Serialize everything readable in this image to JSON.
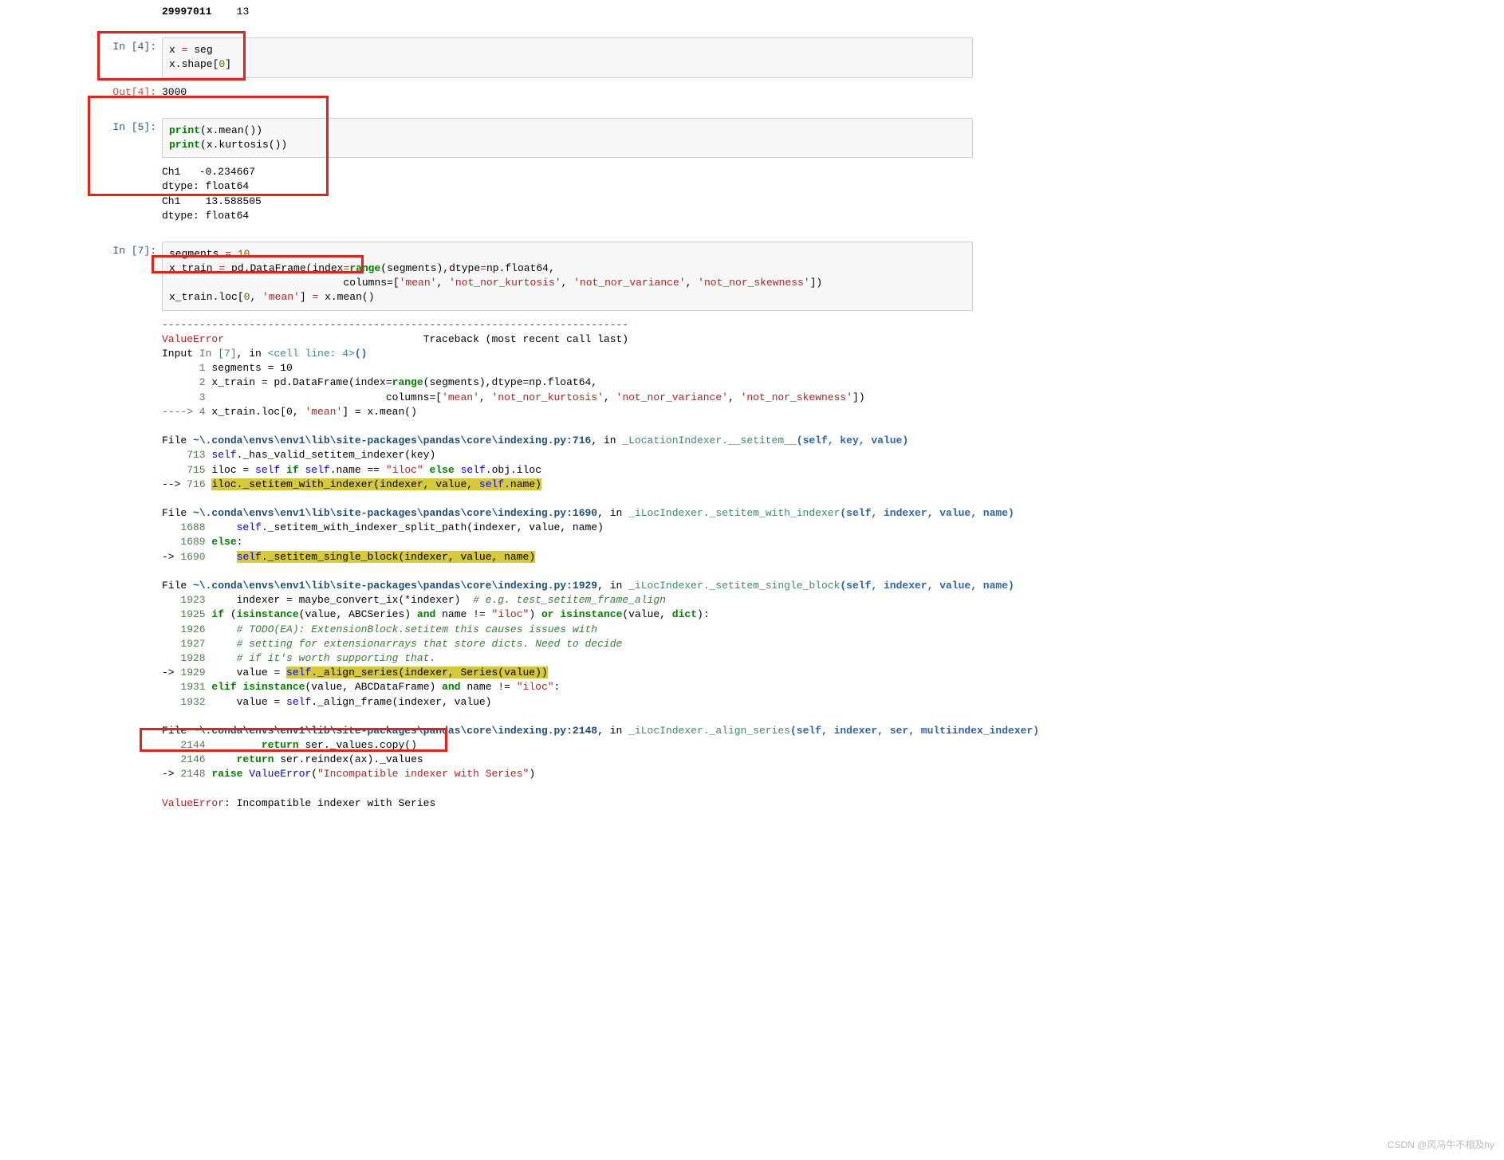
{
  "watermark": "CSDN @风马牛不相及hy",
  "top_out": {
    "a": "29997011",
    "b": "13"
  },
  "cell4": {
    "prompt": "In  [4]:",
    "code_l1a": "x ",
    "op_eq": "=",
    "code_l1b": " seg",
    "code_l2a": "x.shape[",
    "num0": "0",
    "code_l2c": "]"
  },
  "out4": {
    "prompt": "Out[4]:",
    "val": "3000"
  },
  "cell5": {
    "prompt": "In  [5]:",
    "p1": "print",
    "l1b": "(x.mean())",
    "p2": "print",
    "l2b": "(x.kurtosis())"
  },
  "out5": {
    "l1": "Ch1   -0.234667",
    "l2": "dtype: float64",
    "l3": "Ch1    13.588505",
    "l4": "dtype: float64"
  },
  "cell7": {
    "prompt": "In  [7]:",
    "l1a": "segments ",
    "eq": "=",
    "sp": " ",
    "ten": "10",
    "l2a": "x_train ",
    "l2b": " pd.DataFrame(index",
    "l2c": "range",
    "l2d": "(segments),dtype",
    "l2e": "np.float64,",
    "l3a": "                            columns",
    "l3b": "=[",
    "s1": "'mean'",
    "c": ", ",
    "s2": "'not_nor_kurtosis'",
    "s3": "'not_nor_variance'",
    "s4": "'not_nor_skewness'",
    "l3c": "])",
    "l4a": "x_train.loc[",
    "z": "0",
    "l4b": ", ",
    "sm": "'mean'",
    "l4c": "] ",
    "l4d": " x.mean()"
  },
  "tb": {
    "dashes": "---------------------------------------------------------------------------",
    "ve": "ValueError",
    "trace_hdr": "                                Traceback (most recent call last)",
    "inp": "Input ",
    "in7": "In [7]",
    "comma_in": ", in ",
    "cell_line": "<cell line: 4>",
    "parens": "()",
    "ln1": "      1",
    "t1": " segments = 10",
    "ln2": "      2",
    "t2a": " x_train = pd.DataFrame(index=",
    "t2b": "range",
    "t2c": "(segments),dtype=np.float64,",
    "ln3": "      3",
    "t3a": "                             columns=[",
    "t3b": "'mean'",
    "t3cc": ", ",
    "t3c": "'not_nor_kurtosis'",
    "t3d": "'not_nor_variance'",
    "t3e": "'not_nor_skewness'",
    "t3f": "])",
    "arrow4": "----> 4",
    "t4a": " x_train.loc[0, ",
    "t4m": "'mean'",
    "t4b": "] = x.mean()",
    "f1_pre": "File ",
    "tilde": "~",
    "f1_path": "\\.conda\\envs\\env1\\lib\\site-packages\\pandas\\core\\indexing.py:716",
    "f1_in": ", in ",
    "f1_fn": "_LocationIndexer.__setitem__",
    "f1_args": "(self, key, value)",
    "f1_713n": "    713",
    "f1_713": " ",
    "f1_713s": "self",
    "f1_713b": "._has_valid_setitem_indexer(key)",
    "f1_715n": "    715",
    "f1_715a": " iloc = ",
    "self": "self",
    "sp1": " ",
    "if": "if",
    "f1_715b": " ",
    "f1_715c": ".name == ",
    "iloc_str": "\"iloc\"",
    "f1_715d": " ",
    "else": "else",
    "f1_715e": " ",
    "f1_715f": ".obj.iloc",
    "f1_716a": "--> ",
    "f1_716n": "716",
    "f1_716h": "iloc._setitem_with_indexer(indexer, value, ",
    "f1_716s": "self.",
    "f1_716h2": "name)",
    "f2_path": "\\.conda\\envs\\env1\\lib\\site-packages\\pandas\\core\\indexing.py:1690",
    "f2_fn": "_iLocIndexer._setitem_with_indexer",
    "f2_args": "(self, indexer, value, name)",
    "f2_1688n": "   1688",
    "f2_1688": "     ",
    "f2_1688b": "._setitem_with_indexer_split_path(indexer, value, name)",
    "f2_1689n": "   1689",
    "f2_1689a": " ",
    "elset": "else",
    "colon": ":",
    "f2_1690a": "-> ",
    "f2_1690n": "1690",
    "f2_1690sp": "     ",
    "f2_1690h": "self",
    "f2_1690h2": "._setitem_single_block(indexer, value, name)",
    "f3_path": "\\.conda\\envs\\env1\\lib\\site-packages\\pandas\\core\\indexing.py:1929",
    "f3_fn": "_iLocIndexer._setitem_single_block",
    "f3_args": "(self, indexer, value, name)",
    "f3_1923n": "   1923",
    "f3_1923": "     indexer = maybe_convert_ix(*indexer)  ",
    "f3_1923c": "# e.g. test_setitem_frame_align",
    "f3_1925n": "   1925",
    "f3_1925a": " ",
    "f3_1925b": " (",
    "isinst": "isinstance",
    "f3_1925c": "(value, ABCSeries) ",
    "and": "and",
    "f3_1925d": " name != ",
    "f3_1925e": ") ",
    "or": "or",
    "f3_1925f": " ",
    "f3_1925g": "(value, ",
    "dict": "dict",
    "f3_1925h": "):",
    "f3_1926n": "   1926",
    "f3_1926": "     ",
    "f3_1926c": "# TODO(EA): ExtensionBlock.setitem this causes issues with",
    "f3_1927n": "   1927",
    "f3_1927": "     ",
    "f3_1927c": "# setting for extensionarrays that store dicts. Need to decide",
    "f3_1928n": "   1928",
    "f3_1928": "     ",
    "f3_1928c": "# if it's worth supporting that.",
    "f3_1929a": "-> ",
    "f3_1929n": "1929",
    "f3_1929sp": "     value = ",
    "f3_1929h": "self.",
    "f3_1929h2": "_align_series(indexer, Series(value))",
    "f3_1931n": "   1931",
    "f3_1931a": " ",
    "elif": "elif",
    "f3_1931b": " ",
    "f3_1931c": "(value, ABCDataFrame) ",
    "f3_1931d": " name != ",
    "f3_1931e": ":",
    "f3_1932n": "   1932",
    "f3_1932": "     value = ",
    "f3_1932b": "._align_frame(indexer, value)",
    "f4_path": "\\.conda\\envs\\env1\\lib\\site-packages\\pandas\\core\\indexing.py:2148",
    "f4_fn": "_iLocIndexer._align_series",
    "f4_args": "(self, indexer, ser, multiindex_indexer)",
    "f4_2144n": "   2144",
    "f4_2144a": "         ",
    "return": "return",
    "f4_2144b": " ser._values.copy()",
    "f4_2146n": "   2146",
    "f4_2146a": "     ",
    "f4_2146b": " ser.reindex(ax)._values",
    "f4_2148a": "-> ",
    "f4_2148n": "2148",
    "raise": " raise ",
    "f4_2148ve": "ValueError",
    "f4_2148p": "(",
    "f4_2148s": "\"Incompatible indexer with Series\"",
    "f4_2148c": ")",
    "final_ve": "ValueError",
    "final_msg": ": Incompatible indexer with Series"
  }
}
